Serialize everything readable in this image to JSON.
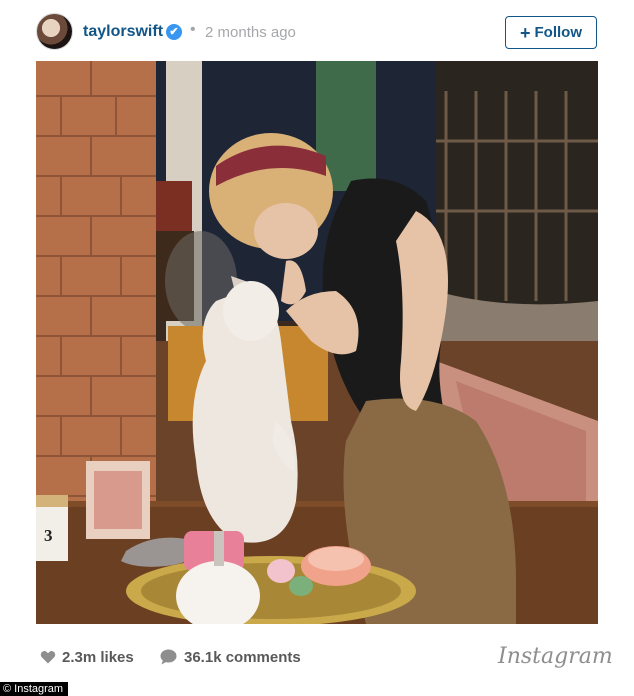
{
  "header": {
    "username": "taylorswift",
    "verified_mark": "✔",
    "separator": "•",
    "time": "2 months ago",
    "follow_plus": "+",
    "follow_label": "Follow"
  },
  "post": {
    "likes": "2.3m likes",
    "comments": "36.1k comments",
    "brand": "Instagram",
    "jar_number": "3"
  },
  "credit": "© Instagram",
  "colors": {
    "username": "#125688",
    "verified": "#3897f0",
    "muted": "#a5a7aa"
  },
  "icons": {
    "likes": "heart-icon",
    "comments": "speech-bubble-icon",
    "verified": "verified-badge-icon"
  }
}
